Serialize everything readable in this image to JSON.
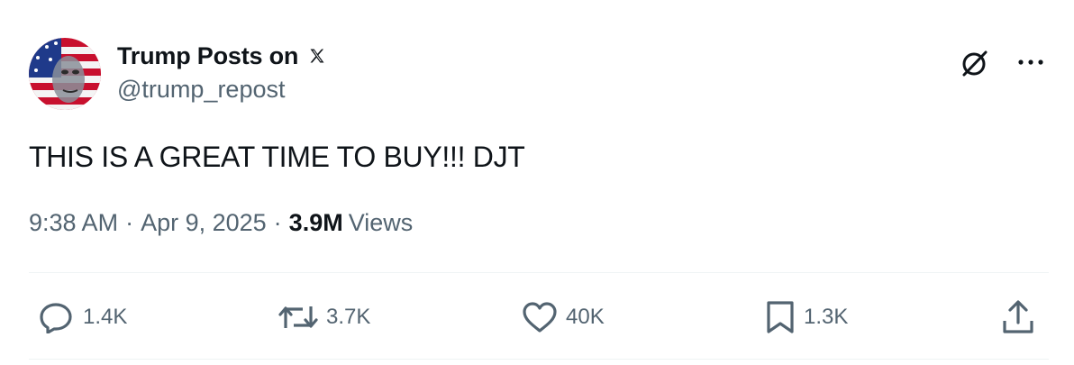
{
  "post": {
    "author": {
      "display_name": "Trump Posts on",
      "verified_glyph": "𝕏",
      "handle": "@trump_repost",
      "avatar_icon": "avatar-flag-portrait-icon"
    },
    "text": "THIS IS A GREAT TIME TO BUY!!! DJT",
    "meta": {
      "time": "9:38 AM",
      "separator": "·",
      "date": "Apr 9, 2025",
      "views_count": "3.9M",
      "views_label": "Views"
    },
    "actions": {
      "reply": {
        "icon": "reply-icon",
        "count": "1.4K"
      },
      "repost": {
        "icon": "repost-icon",
        "count": "3.7K"
      },
      "like": {
        "icon": "heart-icon",
        "count": "40K"
      },
      "bookmark": {
        "icon": "bookmark-icon",
        "count": "1.3K"
      },
      "share": {
        "icon": "share-icon"
      }
    },
    "header_buttons": {
      "grok": "grok-icon",
      "more": "more-dots-icon"
    }
  },
  "colors": {
    "text_primary": "#0f1419",
    "text_secondary": "#536471",
    "divider": "#eff3f4",
    "background": "#ffffff"
  }
}
